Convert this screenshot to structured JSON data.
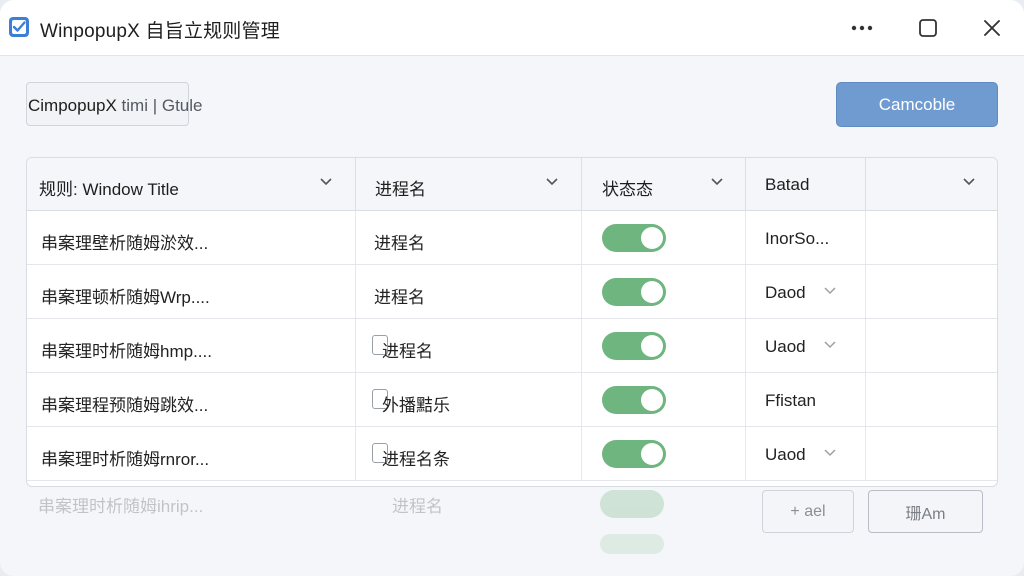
{
  "window": {
    "title": "WinpopupX  自旨立规则管理"
  },
  "toolbar": {
    "left_text_a": "CimpopupX",
    "left_text_b": " timi | Gtule",
    "primary_label": "Camcoble"
  },
  "table": {
    "headers": [
      {
        "label": "规则:  Window Title"
      },
      {
        "label": "进程名"
      },
      {
        "label": "状态态"
      },
      {
        "label": "Batad"
      },
      {
        "label": ""
      }
    ],
    "rows": [
      {
        "rule": "串案理壁析随姆淤效...",
        "process": "进程名",
        "has_checkbox": false,
        "enabled": true,
        "base": "InorSo...",
        "base_chevron": false
      },
      {
        "rule": "串案理顿析随姆Wrp....",
        "process": "进程名",
        "has_checkbox": false,
        "enabled": true,
        "base": "Daod",
        "base_chevron": true
      },
      {
        "rule": "串案理时析随姆hmp....",
        "process": "进程名",
        "has_checkbox": true,
        "enabled": true,
        "base": "Uaod",
        "base_chevron": true
      },
      {
        "rule": "串案理程预随姆跳效...",
        "process": "外播黠乐",
        "has_checkbox": true,
        "enabled": true,
        "base": "Ffistan",
        "base_chevron": false
      },
      {
        "rule": "串案理时析随姆rnror...",
        "process": "进程名条",
        "has_checkbox": true,
        "enabled": true,
        "base": "Uaod",
        "base_chevron": true
      }
    ],
    "ghost_row": {
      "rule": "串案理时析随姆ihrip...",
      "process": "进程名"
    }
  },
  "footer": {
    "add_label": "+ ael",
    "delete_label": "珊Am"
  },
  "colors": {
    "accent": "#6f9bd0",
    "toggle_on": "#6fb57f",
    "app_icon": "#3d7fd6"
  },
  "icons": {
    "app": "checkbox-app-icon",
    "more": "more-icon",
    "maximize": "maximize-icon",
    "close": "close-icon",
    "chevron": "chevron-down-icon"
  }
}
